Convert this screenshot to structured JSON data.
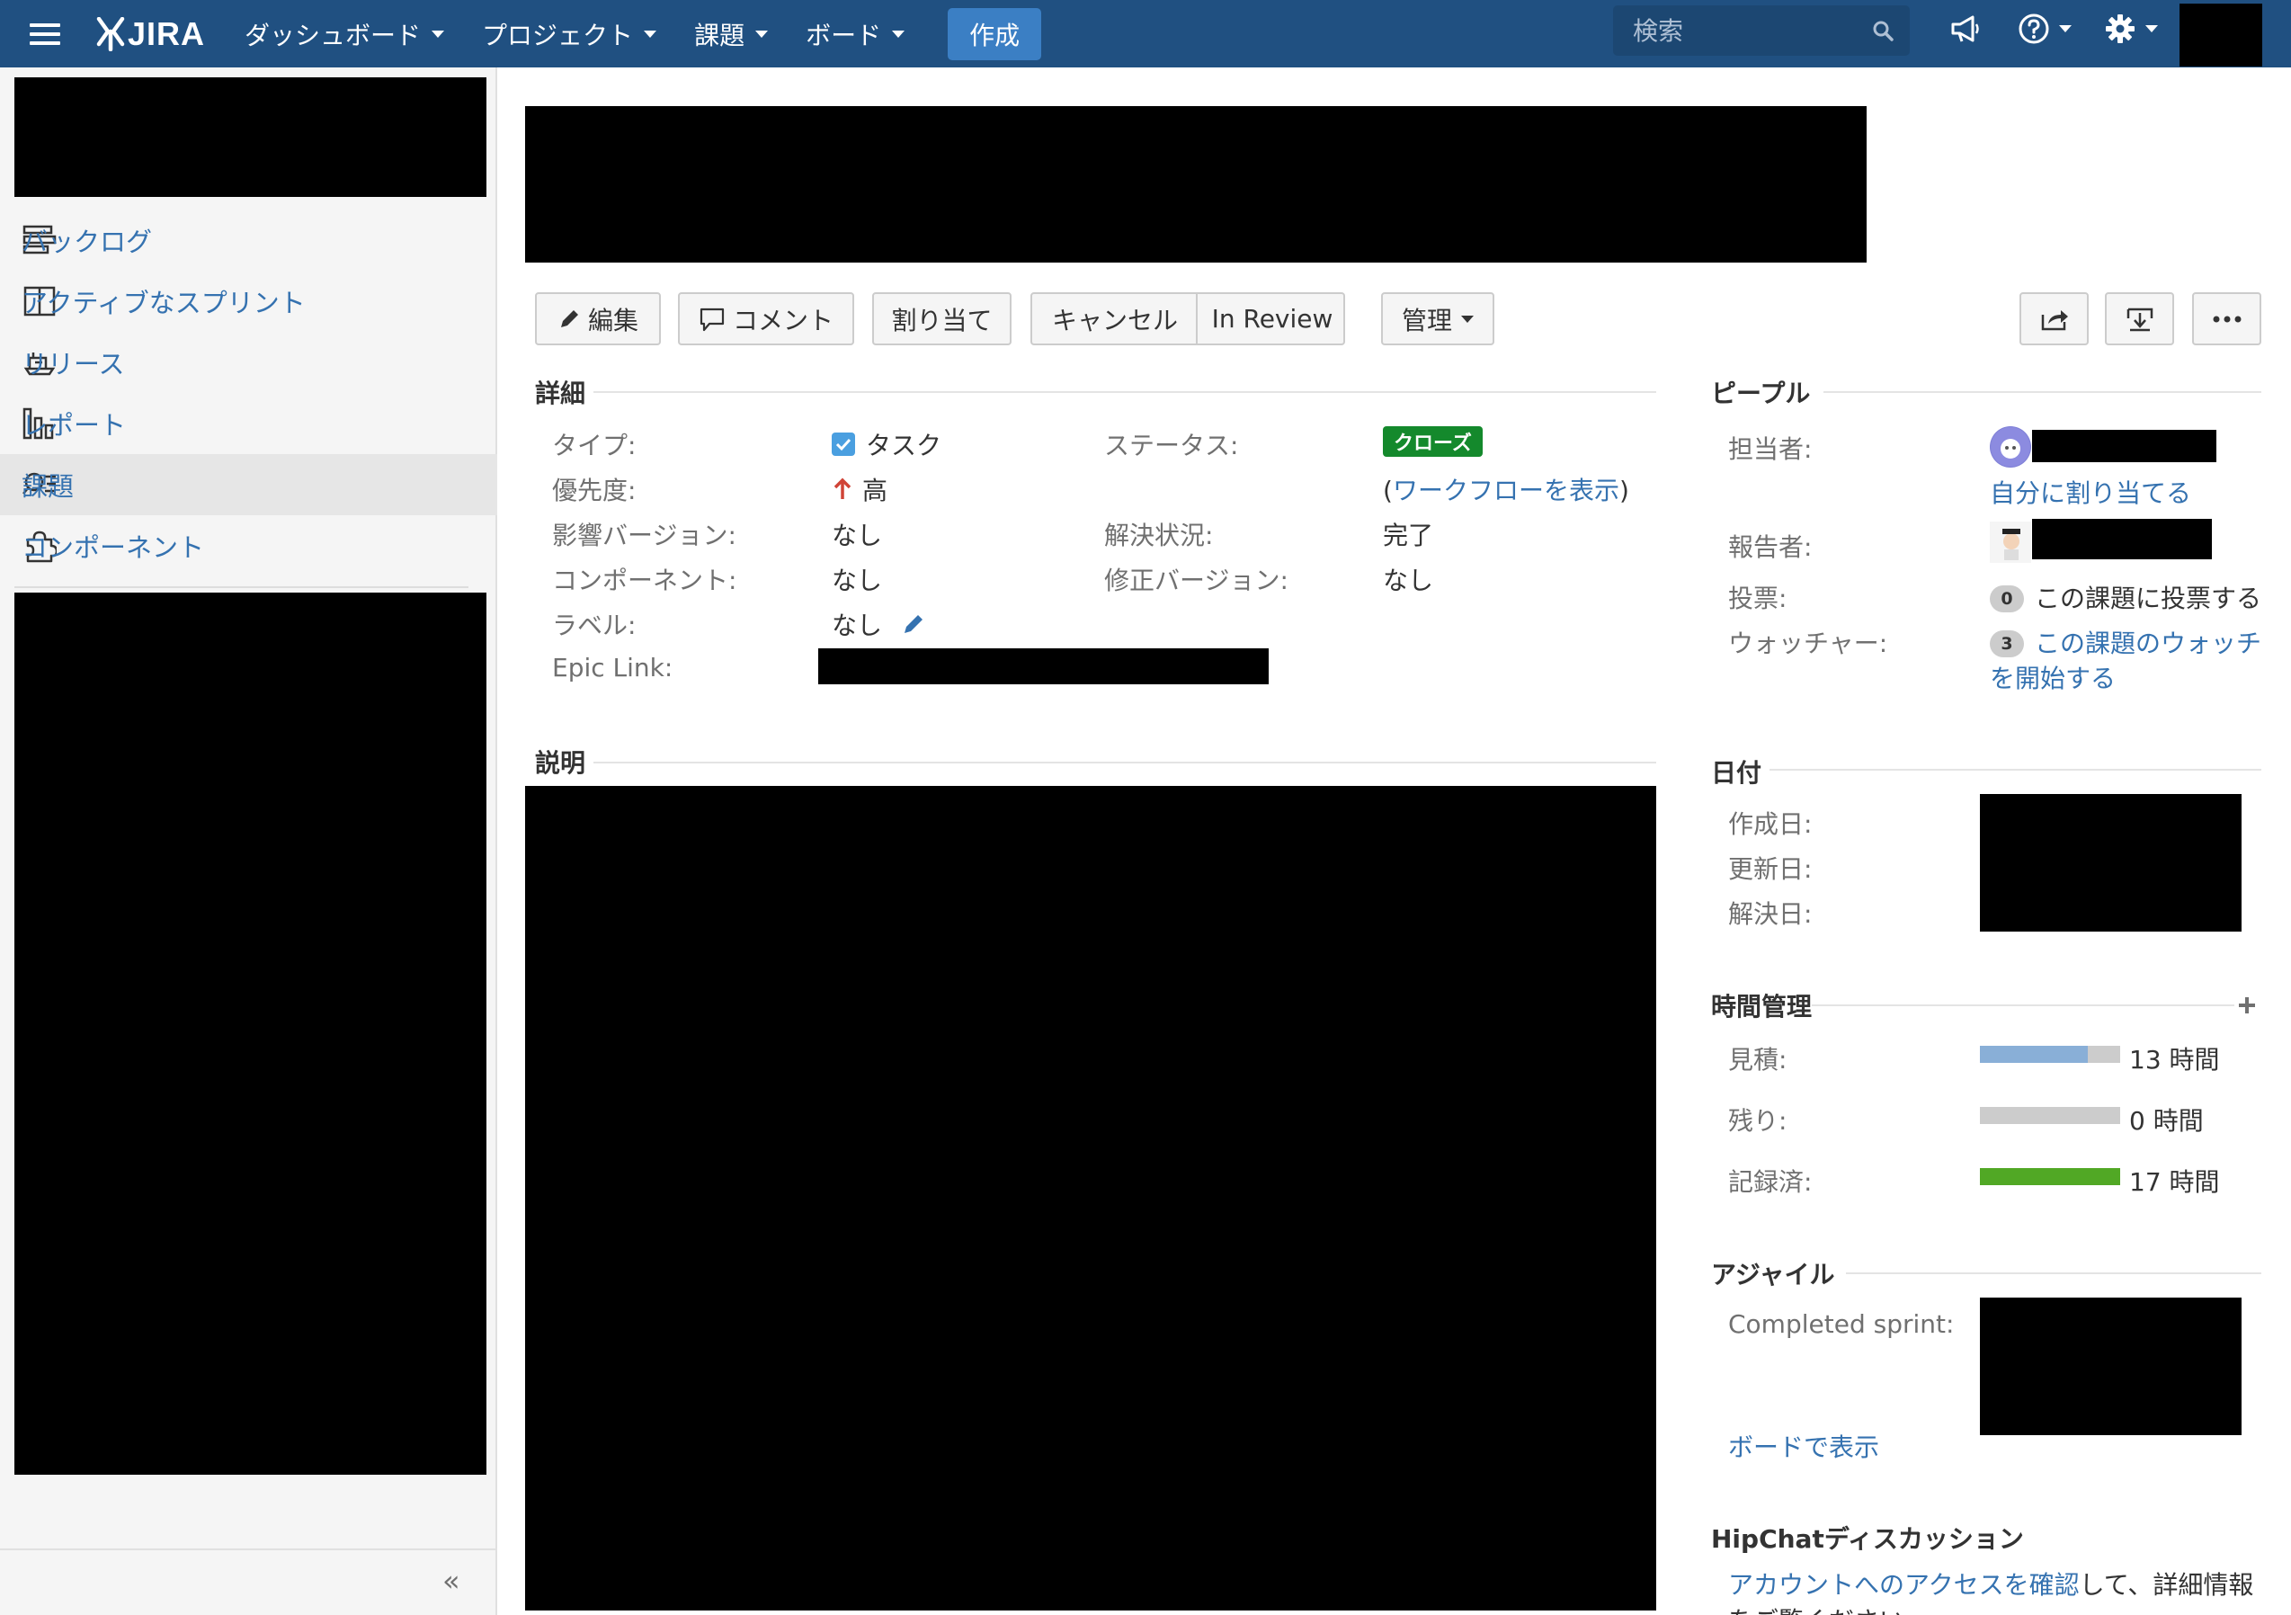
{
  "nav": {
    "logo": "JIRA",
    "items": [
      "ダッシュボード",
      "プロジェクト",
      "課題",
      "ボード"
    ],
    "create": "作成",
    "search_placeholder": "検索"
  },
  "sidebar": {
    "items": [
      {
        "label": "バックログ",
        "icon": "backlog-icon"
      },
      {
        "label": "アクティブなスプリント",
        "icon": "sprint-icon"
      },
      {
        "label": "リリース",
        "icon": "release-icon"
      },
      {
        "label": "レポート",
        "icon": "report-icon"
      },
      {
        "label": "課題",
        "icon": "issues-icon"
      },
      {
        "label": "コンポーネント",
        "icon": "component-icon"
      }
    ],
    "collapse": "«"
  },
  "toolbar": {
    "edit": "編集",
    "comment": "コメント",
    "assign": "割り当て",
    "cancel": "キャンセル",
    "in_review": "In Review",
    "admin": "管理"
  },
  "details": {
    "title": "詳細",
    "type_label": "タイプ:",
    "type_value": "タスク",
    "priority_label": "優先度:",
    "priority_value": "高",
    "affects_label": "影響バージョン:",
    "affects_value": "なし",
    "component_label": "コンポーネント:",
    "component_value": "なし",
    "labels_label": "ラベル:",
    "labels_value": "なし",
    "epic_label": "Epic Link:",
    "status_label": "ステータス:",
    "status_value": "クローズ",
    "workflow_open": "(",
    "workflow_link": "ワークフローを表示",
    "workflow_close": ")",
    "resolution_label": "解決状況:",
    "resolution_value": "完了",
    "fix_label": "修正バージョン:",
    "fix_value": "なし"
  },
  "description": {
    "title": "説明"
  },
  "people": {
    "title": "ピープル",
    "assignee_label": "担当者:",
    "assign_me": "自分に割り当てる",
    "reporter_label": "報告者:",
    "votes_label": "投票:",
    "votes_count": "0",
    "votes_link": "この課題に投票する",
    "watchers_label": "ウォッチャー:",
    "watchers_count": "3",
    "watch_link_1": "この課題のウォッチ",
    "watch_link_2": "を開始する"
  },
  "dates": {
    "title": "日付",
    "created": "作成日:",
    "updated": "更新日:",
    "resolved": "解決日:"
  },
  "time": {
    "title": "時間管理",
    "estimated_label": "見積:",
    "estimated_value": "13 時間",
    "estimated_fill": 0.77,
    "remaining_label": "残り:",
    "remaining_value": "0 時間",
    "remaining_fill": 0,
    "logged_label": "記録済:",
    "logged_value": "17 時間",
    "logged_fill": 1.0,
    "colors": {
      "estimated": "#89afd7",
      "remaining": "#cccccc",
      "logged": "#51a825",
      "track": "#cccccc"
    }
  },
  "agile": {
    "title": "アジャイル",
    "sprint_label": "Completed sprint:",
    "board_link": "ボードで表示"
  },
  "hipchat": {
    "title": "HipChatディスカッション",
    "link": "アカウントへのアクセスを確認",
    "text": "して、詳細情報",
    "text2": "をご覧ください。"
  }
}
